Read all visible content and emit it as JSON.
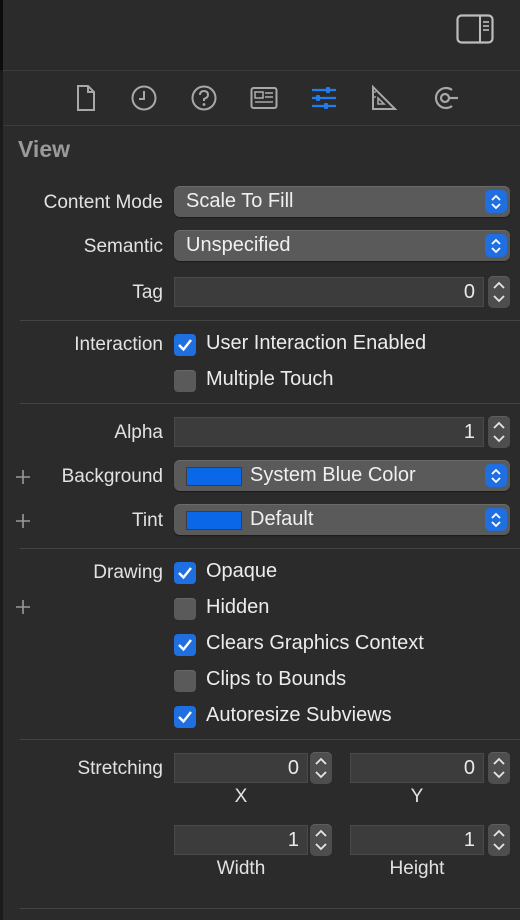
{
  "section": {
    "title": "View"
  },
  "tabs": [
    {
      "id": "file",
      "icon": "file-icon"
    },
    {
      "id": "history",
      "icon": "clock-icon"
    },
    {
      "id": "help",
      "icon": "question-icon"
    },
    {
      "id": "identity",
      "icon": "identity-card-icon"
    },
    {
      "id": "attributes",
      "icon": "sliders-icon",
      "selected": true
    },
    {
      "id": "size",
      "icon": "ruler-icon"
    },
    {
      "id": "connections",
      "icon": "connections-icon"
    }
  ],
  "content_mode": {
    "label": "Content Mode",
    "value": "Scale To Fill"
  },
  "semantic": {
    "label": "Semantic",
    "value": "Unspecified"
  },
  "tag": {
    "label": "Tag",
    "value": "0"
  },
  "interaction": {
    "label": "Interaction",
    "user_interaction": {
      "label": "User Interaction Enabled",
      "checked": true
    },
    "multiple_touch": {
      "label": "Multiple Touch",
      "checked": false
    }
  },
  "alpha": {
    "label": "Alpha",
    "value": "1"
  },
  "background": {
    "label": "Background",
    "value": "System Blue Color",
    "swatch": "#0a68e8"
  },
  "tint": {
    "label": "Tint",
    "value": "Default",
    "swatch": "#0a68e8"
  },
  "drawing": {
    "label": "Drawing",
    "opaque": {
      "label": "Opaque",
      "checked": true
    },
    "hidden": {
      "label": "Hidden",
      "checked": false
    },
    "clears": {
      "label": "Clears Graphics Context",
      "checked": true
    },
    "clips": {
      "label": "Clips to Bounds",
      "checked": false
    },
    "autoresize": {
      "label": "Autoresize Subviews",
      "checked": true
    }
  },
  "stretching": {
    "label": "Stretching",
    "x": {
      "caption": "X",
      "value": "0"
    },
    "y": {
      "caption": "Y",
      "value": "0"
    },
    "width": {
      "caption": "Width",
      "value": "1"
    },
    "height": {
      "caption": "Height",
      "value": "1"
    }
  },
  "colors": {
    "accent": "#1f6fe0",
    "background": "#2b2b2b",
    "popup": "#5a5a5a"
  }
}
